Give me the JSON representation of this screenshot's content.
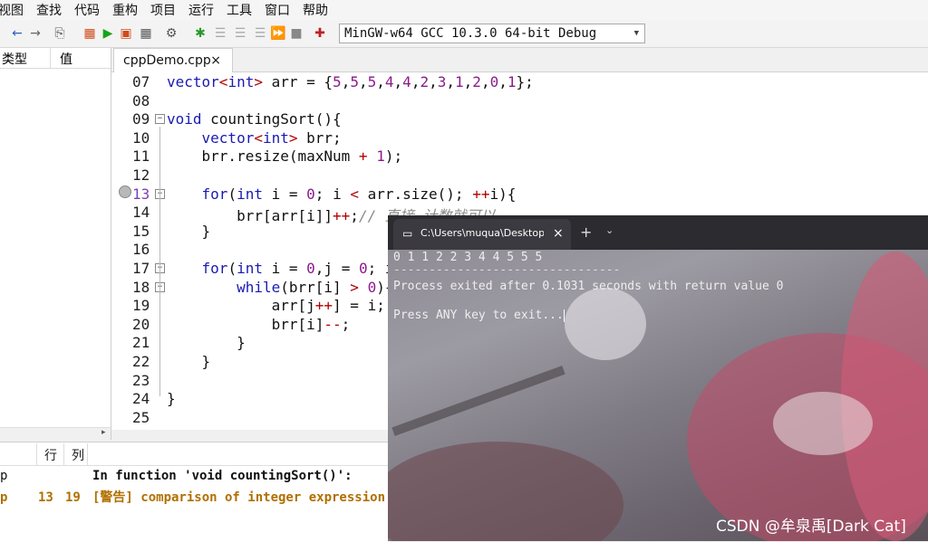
{
  "menu": [
    "视图",
    "查找",
    "代码",
    "重构",
    "项目",
    "运行",
    "工具",
    "窗口",
    "帮助"
  ],
  "toolbar": {
    "compiler": "MinGW-w64 GCC 10.3.0 64-bit Debug"
  },
  "left_panel": {
    "col_type": "类型",
    "col_value": "值"
  },
  "editor": {
    "tab_label": "cppDemo.cpp",
    "tab_close": "×",
    "lines": [
      {
        "num": "07",
        "code": [
          [
            "kt",
            "vector"
          ],
          [
            "op",
            "<"
          ],
          [
            "kt",
            "int"
          ],
          [
            "op",
            ">"
          ],
          [
            "",
            ""
          ],
          [
            "fn",
            " arr = {"
          ],
          [
            "num",
            "5"
          ],
          [
            "",
            ","
          ],
          [
            "num",
            "5"
          ],
          [
            "",
            ","
          ],
          [
            "num",
            "5"
          ],
          [
            "",
            ","
          ],
          [
            "num",
            "4"
          ],
          [
            "",
            ","
          ],
          [
            "num",
            "4"
          ],
          [
            "",
            ","
          ],
          [
            "num",
            "2"
          ],
          [
            "",
            ","
          ],
          [
            "num",
            "3"
          ],
          [
            "",
            ","
          ],
          [
            "num",
            "1"
          ],
          [
            "",
            ","
          ],
          [
            "num",
            "2"
          ],
          [
            "",
            ","
          ],
          [
            "num",
            "0"
          ],
          [
            "",
            ","
          ],
          [
            "num",
            "1"
          ],
          [
            "",
            "};"
          ]
        ]
      },
      {
        "num": "08",
        "code": []
      },
      {
        "num": "09",
        "code": [
          [
            "kw",
            "void"
          ],
          [
            "",
            " countingSort(){"
          ]
        ]
      },
      {
        "num": "10",
        "code": [
          [
            "",
            "    "
          ],
          [
            "kt",
            "vector"
          ],
          [
            "op",
            "<"
          ],
          [
            "kt",
            "int"
          ],
          [
            "op",
            ">"
          ],
          [
            "",
            " brr;"
          ]
        ]
      },
      {
        "num": "11",
        "code": [
          [
            "",
            "    brr.resize(maxNum "
          ],
          [
            "op",
            "+"
          ],
          [
            "",
            " "
          ],
          [
            "num",
            "1"
          ],
          [
            "",
            ");"
          ]
        ]
      },
      {
        "num": "12",
        "code": []
      },
      {
        "num": "13",
        "code": [
          [
            "",
            "    "
          ],
          [
            "kw",
            "for"
          ],
          [
            "",
            "("
          ],
          [
            "kt",
            "int"
          ],
          [
            "",
            " i = "
          ],
          [
            "num",
            "0"
          ],
          [
            "",
            "; i "
          ],
          [
            "op",
            "<"
          ],
          [
            "",
            " arr.size(); "
          ],
          [
            "op",
            "++"
          ],
          [
            "",
            "i){"
          ]
        ]
      },
      {
        "num": "14",
        "code": [
          [
            "",
            "        brr[arr[i]]"
          ],
          [
            "op",
            "++"
          ],
          [
            "",
            ";"
          ],
          [
            "cm",
            "// 直接 计数就可以"
          ]
        ]
      },
      {
        "num": "15",
        "code": [
          [
            "",
            "    }"
          ]
        ]
      },
      {
        "num": "16",
        "code": []
      },
      {
        "num": "17",
        "code": [
          [
            "",
            "    "
          ],
          [
            "kw",
            "for"
          ],
          [
            "",
            "("
          ],
          [
            "kt",
            "int"
          ],
          [
            "",
            " i = "
          ],
          [
            "num",
            "0"
          ],
          [
            "",
            ",j = "
          ],
          [
            "num",
            "0"
          ],
          [
            "",
            "; i"
          ]
        ]
      },
      {
        "num": "18",
        "code": [
          [
            "",
            "        "
          ],
          [
            "kw",
            "while"
          ],
          [
            "",
            "(brr[i] "
          ],
          [
            "op",
            ">"
          ],
          [
            "",
            " "
          ],
          [
            "num",
            "0"
          ],
          [
            "",
            "){"
          ]
        ]
      },
      {
        "num": "19",
        "code": [
          [
            "",
            "            arr[j"
          ],
          [
            "op",
            "++"
          ],
          [
            "",
            "] = i;"
          ]
        ]
      },
      {
        "num": "20",
        "code": [
          [
            "",
            "            brr[i]"
          ],
          [
            "op",
            "--"
          ],
          [
            "",
            ";"
          ]
        ]
      },
      {
        "num": "21",
        "code": [
          [
            "",
            "        }"
          ]
        ]
      },
      {
        "num": "22",
        "code": [
          [
            "",
            "    }"
          ]
        ]
      },
      {
        "num": "23",
        "code": []
      },
      {
        "num": "24",
        "code": [
          [
            "",
            "}"
          ]
        ]
      },
      {
        "num": "25",
        "code": []
      }
    ]
  },
  "bottom": {
    "col_line": "行",
    "col_col": "列",
    "row1_msg": "In function 'void countingSort()':",
    "row1_file": "p",
    "row2_file": "p",
    "row2_line": "13",
    "row2_col": "19",
    "row2_msg": "[警告] comparison of integer expression"
  },
  "console": {
    "tab_title": "C:\\Users\\muqua\\Desktop\\cpp",
    "output": "0 1 1 2 2 3 4 4 5 5 5",
    "separator": "--------------------------------",
    "exit_msg": "Process exited after 0.1031 seconds with return value 0",
    "prompt": "Press ANY key to exit..."
  },
  "watermark": "CSDN @牟泉禹[Dark Cat]"
}
